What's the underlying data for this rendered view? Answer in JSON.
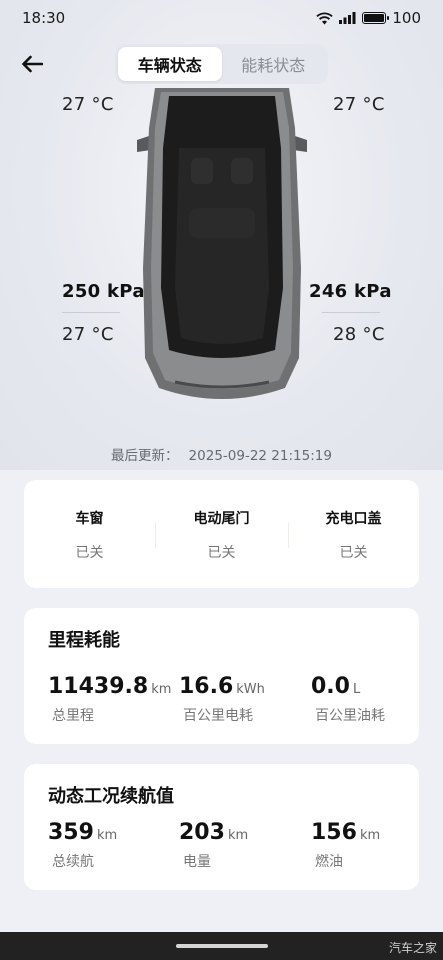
{
  "status_bar": {
    "time": "18:30",
    "battery": "100"
  },
  "tabs": [
    {
      "label": "车辆状态",
      "active": true
    },
    {
      "label": "能耗状态",
      "active": false
    }
  ],
  "tires": {
    "front_left": {
      "temp": "27 °C"
    },
    "front_right": {
      "temp": "27 °C"
    },
    "rear_left": {
      "pressure": "250 kPa",
      "temp": "27 °C"
    },
    "rear_right": {
      "pressure": "246 kPa",
      "temp": "28 °C"
    }
  },
  "last_update": {
    "label": "最后更新：",
    "value": "2025-09-22 21:15:19"
  },
  "vehicle_status": [
    {
      "name": "车窗",
      "state": "已关"
    },
    {
      "name": "电动尾门",
      "state": "已关"
    },
    {
      "name": "充电口盖",
      "state": "已关"
    }
  ],
  "mileage": {
    "title": "里程耗能",
    "items": [
      {
        "value": "11439.8",
        "unit": "km",
        "label": "总里程"
      },
      {
        "value": "16.6",
        "unit": "kWh",
        "label": "百公里电耗"
      },
      {
        "value": "0.0",
        "unit": "L",
        "label": "百公里油耗"
      }
    ]
  },
  "range": {
    "title": "动态工况续航值",
    "items": [
      {
        "value": "359",
        "unit": "km",
        "label": "总续航"
      },
      {
        "value": "203",
        "unit": "km",
        "label": "电量"
      },
      {
        "value": "156",
        "unit": "km",
        "label": "燃油"
      }
    ]
  },
  "watermark": "汽车之家",
  "colors": {
    "page_bg": "#eef0f5",
    "card_bg": "#ffffff",
    "car_body": "#6e7072",
    "car_roof": "#1a1a1a"
  }
}
